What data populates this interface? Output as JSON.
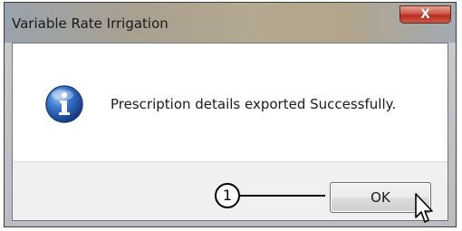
{
  "window": {
    "title": "Variable Rate Irrigation",
    "close_glyph": "X"
  },
  "dialog": {
    "message": "Prescription details exported Successfully.",
    "ok_label": "OK",
    "icon": "information-icon"
  },
  "annotation": {
    "callout_number": "1"
  },
  "cursor": {
    "icon": "mouse-pointer-icon"
  },
  "colors": {
    "info_icon": "#2a5fb0",
    "close_button": "#c6403a"
  }
}
